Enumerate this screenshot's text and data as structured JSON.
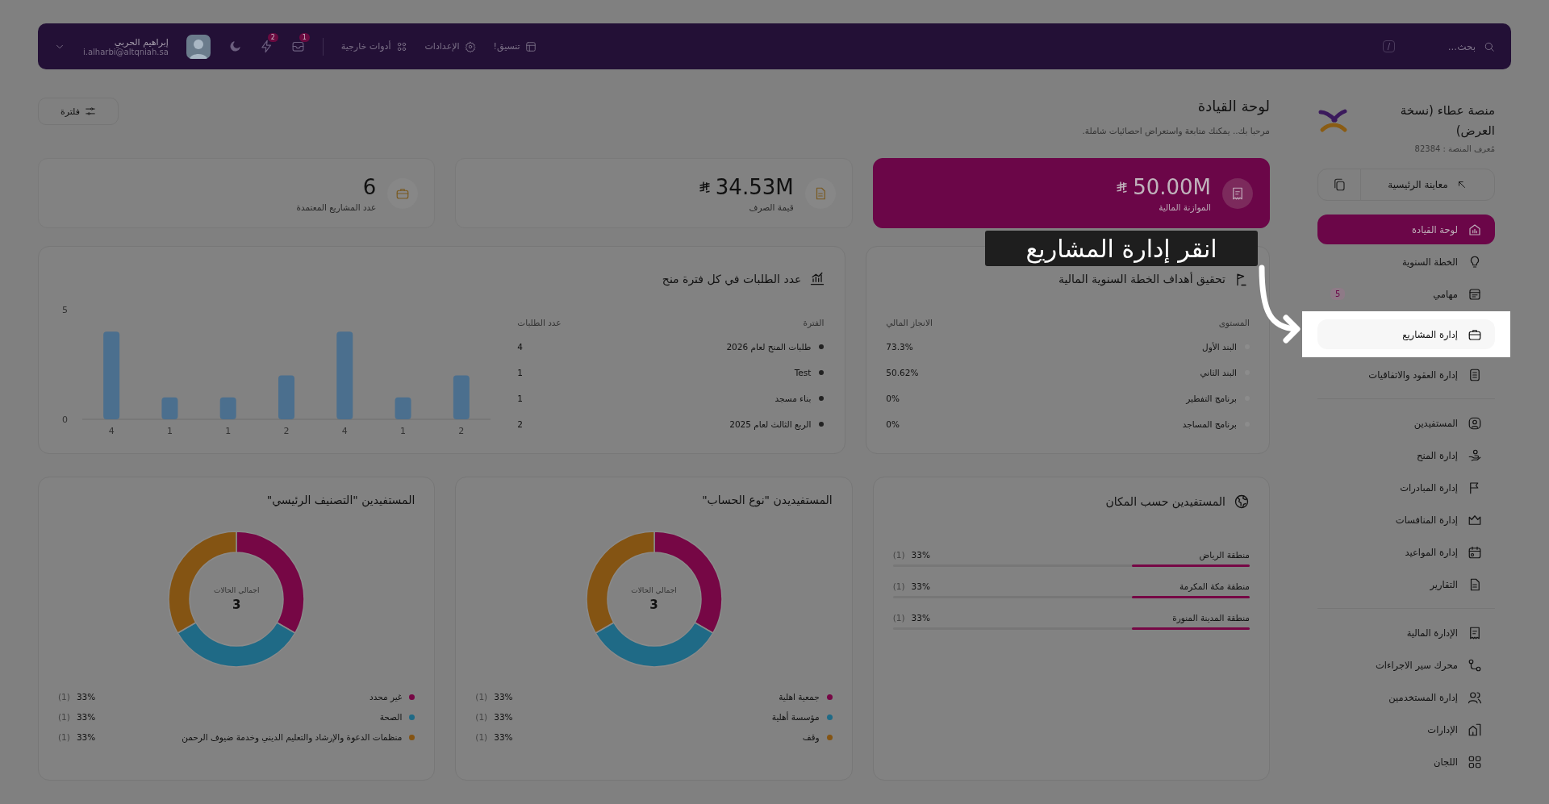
{
  "top_bar": {
    "search": {
      "placeholder": "بحث..."
    },
    "shortcut_key": "/",
    "menu": [
      {
        "label": "تنسيق!"
      },
      {
        "label": "الإعدادات"
      },
      {
        "label": "أدوات خارجية"
      }
    ],
    "notifications": [
      {
        "badge": "1"
      },
      {
        "badge": "2"
      }
    ],
    "user": {
      "name": "إبراهيم الحربي",
      "email": "i.alharbi@altqniah.sa"
    }
  },
  "sidebar": {
    "title": "منصة عطاء (نسخة العرض)",
    "platform_id": "مُعرف المنصة : 82384",
    "preview_button": "معاينة الرئيسية",
    "groups": [
      {
        "items": [
          {
            "label": "لوحة القيادة",
            "selected": true,
            "spotlight": false
          },
          {
            "label": "الخطة السنوية",
            "selected": false,
            "spotlight": false
          },
          {
            "label": "مهامي",
            "selected": false,
            "spotlight": false,
            "badge": "5"
          },
          {
            "label": "إدارة المشاريع",
            "selected": false,
            "spotlight": true
          },
          {
            "label": "إدارة العقود والاتفاقيات",
            "selected": false,
            "spotlight": false
          }
        ]
      },
      {
        "items": [
          {
            "label": "المستفيدين",
            "selected": false,
            "spotlight": false
          },
          {
            "label": "إدارة المنح",
            "selected": false,
            "spotlight": false
          },
          {
            "label": "إدارة المبادرات",
            "selected": false,
            "spotlight": false
          },
          {
            "label": "إدارة المنافسات",
            "selected": false,
            "spotlight": false
          },
          {
            "label": "إدارة المواعيد",
            "selected": false,
            "spotlight": false
          },
          {
            "label": "التقارير",
            "selected": false,
            "spotlight": false
          }
        ]
      },
      {
        "items": [
          {
            "label": "الإدارة المالية",
            "selected": false,
            "spotlight": false
          },
          {
            "label": "محرك سير الاجراءات",
            "selected": false,
            "spotlight": false
          },
          {
            "label": "إدارة المستخدمين",
            "selected": false,
            "spotlight": false
          },
          {
            "label": "الإدارات",
            "selected": false,
            "spotlight": false
          },
          {
            "label": "اللجان",
            "selected": false,
            "spotlight": false
          }
        ]
      }
    ]
  },
  "header": {
    "title": "لوحة القيادة",
    "subtitle": "مرحبا بك.. يمكنك متابعة واستعراض احصائيات شاملة.",
    "filter_button": "فلترة"
  },
  "stats": [
    {
      "value": "50.00M",
      "currency": true,
      "label": "الموازنة المالية",
      "highlighted": true
    },
    {
      "value": "34.53M",
      "currency": true,
      "label": "قيمة الصرف",
      "highlighted": false
    },
    {
      "value": "6",
      "currency": false,
      "label": "عدد المشاريع المعتمدة",
      "highlighted": false
    }
  ],
  "annual_plan": {
    "title": "تحقيق أهداف الخطة السنوية المالية",
    "columns": [
      "المستوى",
      "الانجاز المالي"
    ],
    "rows": [
      {
        "level": "البند الأول",
        "achievement": "73.3%"
      },
      {
        "level": "البند الثاني",
        "achievement": "50.62%"
      },
      {
        "level": "برنامج التفطير",
        "achievement": "0%"
      },
      {
        "level": "برنامج المساجد",
        "achievement": "0%"
      }
    ]
  },
  "grants": {
    "title": "عدد الطلبات في كل فترة منح",
    "columns": [
      "الفترة",
      "عدد الطلبات"
    ],
    "rows": [
      {
        "period": "طلبات المنح لعام 2026",
        "count": "4"
      },
      {
        "period": "Test",
        "count": "1"
      },
      {
        "period": "بناء مسجد",
        "count": "1"
      },
      {
        "period": "الربع الثالث لعام 2025",
        "count": "2"
      }
    ],
    "chart_data": {
      "type": "bar",
      "categories": [
        "4",
        "1",
        "1",
        "2",
        "4",
        "1",
        "2"
      ],
      "values": [
        4,
        1,
        1,
        2,
        4,
        1,
        2
      ],
      "ylim": [
        0,
        5
      ],
      "yticks": [
        0,
        5
      ]
    }
  },
  "location": {
    "title": "المستفيدين حسب المكان",
    "rows": [
      {
        "name": "منطقة الرياض",
        "count": "(1)",
        "percent": "33%",
        "level": 0.33
      },
      {
        "name": "منطقة مكة المكرمة",
        "count": "(1)",
        "percent": "33%",
        "level": 0.33
      },
      {
        "name": "منطقة المدينة المنورة",
        "count": "(1)",
        "percent": "33%",
        "level": 0.33
      }
    ]
  },
  "donuts": [
    {
      "title": "المستفيديدن \"نوع الحساب\"",
      "center_label": "اجمالي الحالات",
      "total": "3",
      "chart_data": {
        "type": "donut",
        "values": [
          33,
          33,
          33
        ]
      },
      "legend": [
        {
          "label": "جمعية اهلية",
          "color": "#760745",
          "count": "(1)",
          "percent": "33%"
        },
        {
          "label": "مؤسسة أهلية",
          "color": "#1f6a86",
          "count": "(1)",
          "percent": "33%"
        },
        {
          "label": "وقف",
          "color": "#845413",
          "count": "(1)",
          "percent": "33%"
        }
      ]
    },
    {
      "title": "المستفيدين \"التصنيف الرئيسي\"",
      "center_label": "اجمالي الحالات",
      "total": "3",
      "chart_data": {
        "type": "donut",
        "values": [
          33,
          33,
          33
        ]
      },
      "legend": [
        {
          "label": "غير محدد",
          "color": "#760745",
          "count": "(1)",
          "percent": "33%"
        },
        {
          "label": "الصحة",
          "color": "#1f6a86",
          "count": "(1)",
          "percent": "33%"
        },
        {
          "label": "منظمات الدعوة والإرشاد والتعليم الديني وخدمة ضيوف الرحمن",
          "color": "#845413",
          "count": "(1)",
          "percent": "33%"
        }
      ]
    }
  ],
  "tutorial": {
    "text": "انقر إدارة المشاريع"
  }
}
